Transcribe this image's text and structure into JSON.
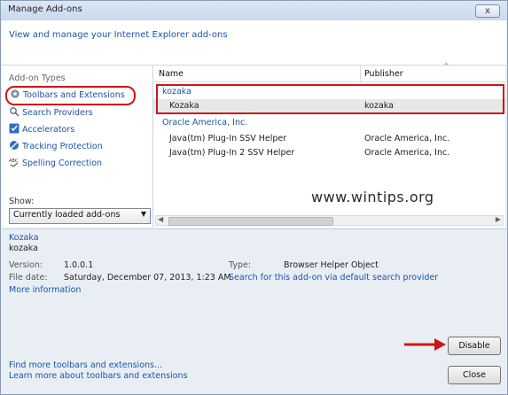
{
  "window": {
    "title": "Manage Add-ons",
    "close_glyph": "x",
    "subtitle": "View and manage your Internet Explorer add-ons"
  },
  "sidebar": {
    "heading": "Add-on Types",
    "items": [
      {
        "label": "Toolbars and Extensions",
        "icon": "gear-icon"
      },
      {
        "label": "Search Providers",
        "icon": "search-icon"
      },
      {
        "label": "Accelerators",
        "icon": "accelerator-icon"
      },
      {
        "label": "Tracking Protection",
        "icon": "tracking-protection-icon"
      },
      {
        "label": "Spelling Correction",
        "icon": "spelling-icon"
      }
    ],
    "show_label": "Show:",
    "show_selected": "Currently loaded add-ons"
  },
  "list": {
    "columns": [
      "Name",
      "Publisher"
    ],
    "groups": [
      {
        "name": "kozaka",
        "rows": [
          {
            "name": "Kozaka",
            "publisher": "kozaka"
          }
        ]
      },
      {
        "name": "Oracle America, Inc.",
        "rows": [
          {
            "name": "Java(tm) Plug-In SSV Helper",
            "publisher": "Oracle America, Inc."
          },
          {
            "name": "Java(tm) Plug-In 2 SSV Helper",
            "publisher": "Oracle America, Inc."
          }
        ]
      }
    ]
  },
  "watermark": "www.wintips.org",
  "details": {
    "name": "Kozaka",
    "publisher": "kozaka",
    "version_label": "Version:",
    "version_value": "1.0.0.1",
    "filedate_label": "File date:",
    "filedate_value": "Saturday, December 07, 2013, 1:23 AM",
    "type_label": "Type:",
    "type_value": "Browser Helper Object",
    "search_link": "Search for this add-on via default search provider",
    "more_info": "More information",
    "disable_button": "Disable"
  },
  "footer": {
    "link1": "Find more toolbars and extensions...",
    "link2": "Learn more about toolbars and extensions",
    "close_button": "Close"
  },
  "colors": {
    "link": "#1a55a6",
    "highlight": "#d01515",
    "selected_row": "#e8e8e8"
  }
}
